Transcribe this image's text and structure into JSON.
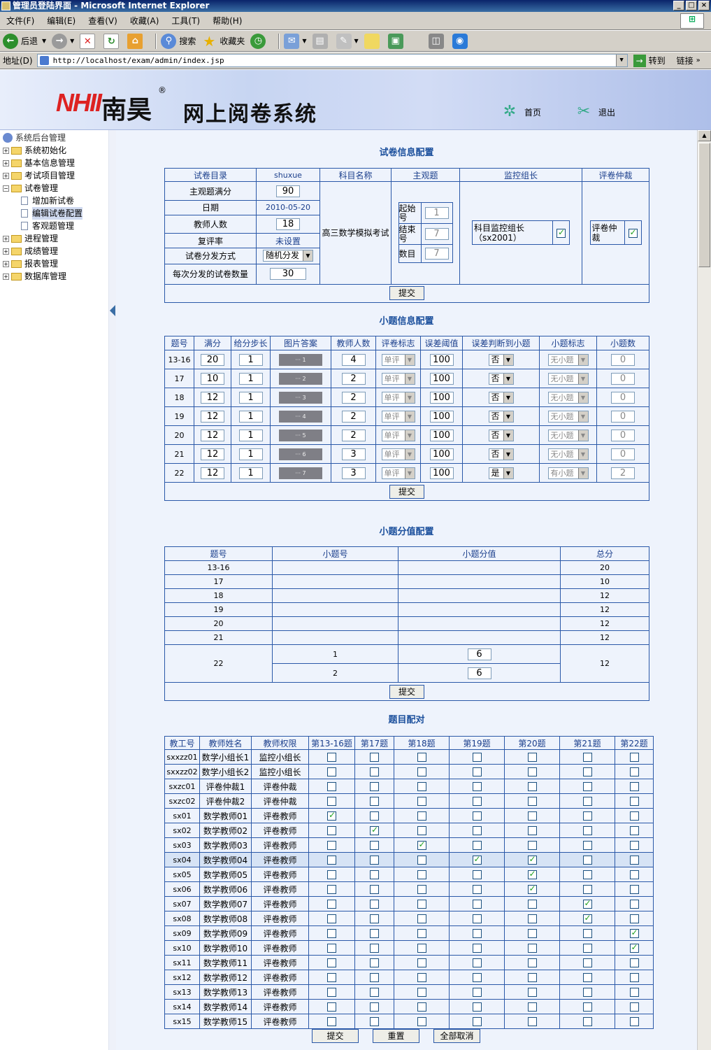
{
  "window": {
    "title": "管理员登陆界面 - Microsoft Internet Explorer"
  },
  "menu": [
    "文件(F)",
    "编辑(E)",
    "查看(V)",
    "收藏(A)",
    "工具(T)",
    "帮助(H)"
  ],
  "toolbar": {
    "back": "后退",
    "search": "搜索",
    "favorites": "收藏夹"
  },
  "address": {
    "label": "地址(D)",
    "url": "http://localhost/exam/admin/index.jsp",
    "go": "转到",
    "links": "链接"
  },
  "header": {
    "brand": "NHII",
    "brand_cn": "南昊",
    "reg": "®",
    "title": "网上阅卷系统",
    "home": "首页",
    "logout": "退出"
  },
  "sidebar": {
    "root": "系统后台管理",
    "items": [
      {
        "label": "系统初始化",
        "open": false
      },
      {
        "label": "基本信息管理",
        "open": false
      },
      {
        "label": "考试项目管理",
        "open": false
      },
      {
        "label": "试卷管理",
        "open": true
      },
      {
        "label": "增加新试卷",
        "child": true
      },
      {
        "label": "编辑试卷配置",
        "child": true,
        "selected": true
      },
      {
        "label": "客观题管理",
        "child": true
      },
      {
        "label": "进程管理",
        "open": false
      },
      {
        "label": "成绩管理",
        "open": false
      },
      {
        "label": "报表管理",
        "open": false
      },
      {
        "label": "数据库管理",
        "open": false
      }
    ]
  },
  "paper": {
    "section_title": "试卷信息配置",
    "h_catalog": "试卷目录",
    "catalog": "shuxue",
    "h_subject": "科目名称",
    "h_subjective": "主观题",
    "h_monitor": "监控组长",
    "h_arbiter": "评卷仲裁",
    "l_fullscore": "主观题满分",
    "fullscore": "90",
    "l_date": "日期",
    "date": "2010-05-20",
    "l_teachers": "教师人数",
    "teachers": "18",
    "l_review": "复评率",
    "review": "未设置",
    "l_method": "试卷分发方式",
    "method": "随机分发",
    "l_per": "每次分发的试卷数量",
    "per": "30",
    "subject": "高三数学模拟考试",
    "l_start": "起始号",
    "start": "1",
    "l_end": "结束号",
    "end": "7",
    "l_count": "数目",
    "count": "7",
    "monitor": "科目监控组长（sx2001）",
    "arbiter": "评卷仲裁",
    "submit": "提交"
  },
  "items": {
    "section_title": "小题信息配置",
    "headers": [
      "题号",
      "满分",
      "给分步长",
      "图片答案",
      "教师人数",
      "评卷标志",
      "误差阈值",
      "误差判断到小题",
      "小题标志",
      "小题数"
    ],
    "rows": [
      {
        "no": "13-16",
        "full": "20",
        "step": "1",
        "img": "··· 1",
        "teachers": "4",
        "flag": "单评",
        "thr": "100",
        "judge": "否",
        "sub": "无小题",
        "cnt": "0"
      },
      {
        "no": "17",
        "full": "10",
        "step": "1",
        "img": "··· 2",
        "teachers": "2",
        "flag": "单评",
        "thr": "100",
        "judge": "否",
        "sub": "无小题",
        "cnt": "0"
      },
      {
        "no": "18",
        "full": "12",
        "step": "1",
        "img": "··· 3",
        "teachers": "2",
        "flag": "单评",
        "thr": "100",
        "judge": "否",
        "sub": "无小题",
        "cnt": "0"
      },
      {
        "no": "19",
        "full": "12",
        "step": "1",
        "img": "··· 4",
        "teachers": "2",
        "flag": "单评",
        "thr": "100",
        "judge": "否",
        "sub": "无小题",
        "cnt": "0"
      },
      {
        "no": "20",
        "full": "12",
        "step": "1",
        "img": "··· 5",
        "teachers": "2",
        "flag": "单评",
        "thr": "100",
        "judge": "否",
        "sub": "无小题",
        "cnt": "0"
      },
      {
        "no": "21",
        "full": "12",
        "step": "1",
        "img": "··· 6",
        "teachers": "3",
        "flag": "单评",
        "thr": "100",
        "judge": "否",
        "sub": "无小题",
        "cnt": "0"
      },
      {
        "no": "22",
        "full": "12",
        "step": "1",
        "img": "··· 7",
        "teachers": "3",
        "flag": "单评",
        "thr": "100",
        "judge": "是",
        "sub": "有小题",
        "cnt": "2"
      }
    ],
    "submit": "提交"
  },
  "scores": {
    "section_title": "小题分值配置",
    "headers": [
      "题号",
      "小题号",
      "小题分值",
      "总分"
    ],
    "rows": [
      {
        "no": "13-16",
        "total": "20"
      },
      {
        "no": "17",
        "total": "10"
      },
      {
        "no": "18",
        "total": "12"
      },
      {
        "no": "19",
        "total": "12"
      },
      {
        "no": "20",
        "total": "12"
      },
      {
        "no": "21",
        "total": "12"
      }
    ],
    "last": {
      "no": "22",
      "total": "12",
      "subs": [
        {
          "sub": "1",
          "val": "6"
        },
        {
          "sub": "2",
          "val": "6"
        }
      ]
    },
    "submit": "提交"
  },
  "assign": {
    "section_title": "题目配对",
    "headers": [
      "教工号",
      "教师姓名",
      "教师权限",
      "第13-16题",
      "第17题",
      "第18题",
      "第19题",
      "第20题",
      "第21题",
      "第22题"
    ],
    "rows": [
      {
        "id": "sxxzz01",
        "name": "数学小组长1",
        "role": "监控小组长",
        "c": [
          0,
          0,
          0,
          0,
          0,
          0,
          0
        ]
      },
      {
        "id": "sxxzz02",
        "name": "数学小组长2",
        "role": "监控小组长",
        "c": [
          0,
          0,
          0,
          0,
          0,
          0,
          0
        ]
      },
      {
        "id": "sxzc01",
        "name": "评卷仲裁1",
        "role": "评卷仲裁",
        "c": [
          0,
          0,
          0,
          0,
          0,
          0,
          0
        ]
      },
      {
        "id": "sxzc02",
        "name": "评卷仲裁2",
        "role": "评卷仲裁",
        "c": [
          0,
          0,
          0,
          0,
          0,
          0,
          0
        ]
      },
      {
        "id": "sx01",
        "name": "数学教师01",
        "role": "评卷教师",
        "c": [
          1,
          0,
          0,
          0,
          0,
          0,
          0
        ]
      },
      {
        "id": "sx02",
        "name": "数学教师02",
        "role": "评卷教师",
        "c": [
          0,
          1,
          0,
          0,
          0,
          0,
          0
        ]
      },
      {
        "id": "sx03",
        "name": "数学教师03",
        "role": "评卷教师",
        "c": [
          0,
          0,
          1,
          0,
          0,
          0,
          0
        ]
      },
      {
        "id": "sx04",
        "name": "数学教师04",
        "role": "评卷教师",
        "c": [
          0,
          0,
          0,
          1,
          1,
          0,
          0
        ],
        "hl": true
      },
      {
        "id": "sx05",
        "name": "数学教师05",
        "role": "评卷教师",
        "c": [
          0,
          0,
          0,
          0,
          1,
          0,
          0
        ]
      },
      {
        "id": "sx06",
        "name": "数学教师06",
        "role": "评卷教师",
        "c": [
          0,
          0,
          0,
          0,
          1,
          0,
          0
        ]
      },
      {
        "id": "sx07",
        "name": "数学教师07",
        "role": "评卷教师",
        "c": [
          0,
          0,
          0,
          0,
          0,
          1,
          0
        ]
      },
      {
        "id": "sx08",
        "name": "数学教师08",
        "role": "评卷教师",
        "c": [
          0,
          0,
          0,
          0,
          0,
          1,
          0
        ]
      },
      {
        "id": "sx09",
        "name": "数学教师09",
        "role": "评卷教师",
        "c": [
          0,
          0,
          0,
          0,
          0,
          0,
          1
        ]
      },
      {
        "id": "sx10",
        "name": "数学教师10",
        "role": "评卷教师",
        "c": [
          0,
          0,
          0,
          0,
          0,
          0,
          1
        ]
      },
      {
        "id": "sx11",
        "name": "数学教师11",
        "role": "评卷教师",
        "c": [
          0,
          0,
          0,
          0,
          0,
          0,
          0
        ]
      },
      {
        "id": "sx12",
        "name": "数学教师12",
        "role": "评卷教师",
        "c": [
          0,
          0,
          0,
          0,
          0,
          0,
          0
        ]
      },
      {
        "id": "sx13",
        "name": "数学教师13",
        "role": "评卷教师",
        "c": [
          0,
          0,
          0,
          0,
          0,
          0,
          0
        ]
      },
      {
        "id": "sx14",
        "name": "数学教师14",
        "role": "评卷教师",
        "c": [
          0,
          0,
          0,
          0,
          0,
          0,
          0
        ]
      },
      {
        "id": "sx15",
        "name": "数学教师15",
        "role": "评卷教师",
        "c": [
          0,
          0,
          0,
          0,
          0,
          0,
          0
        ]
      }
    ],
    "submit": "提交",
    "reset": "重置",
    "cancel_all": "全部取消"
  }
}
